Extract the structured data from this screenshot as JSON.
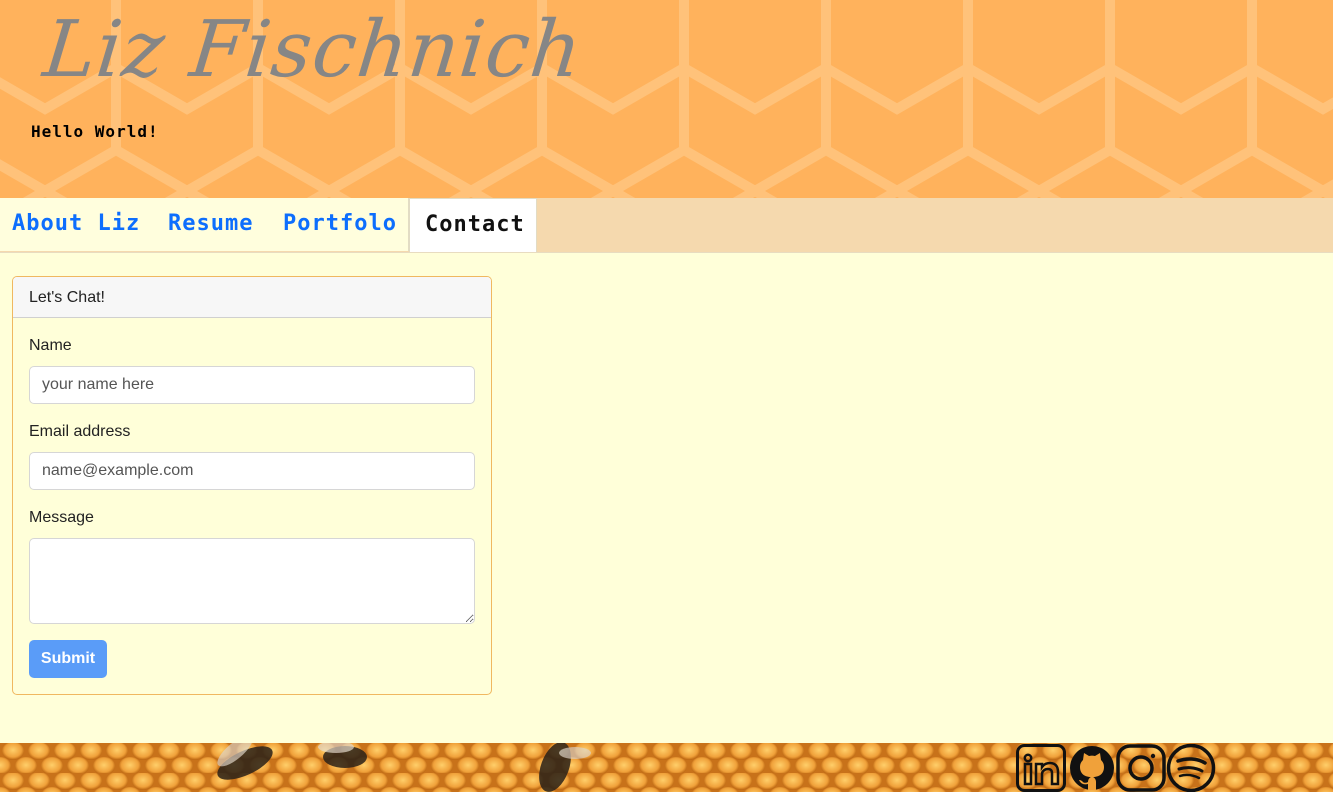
{
  "header": {
    "title": "Liz Fischnich",
    "tagline": "Hello World!"
  },
  "nav": {
    "tabs": [
      {
        "label": "About Liz",
        "active": false
      },
      {
        "label": "Resume",
        "active": false
      },
      {
        "label": "Portfolo",
        "active": false
      },
      {
        "label": "Contact",
        "active": true
      }
    ]
  },
  "contact_form": {
    "heading": "Let's Chat!",
    "name_label": "Name",
    "name_placeholder": "your name here",
    "name_value": "",
    "email_label": "Email address",
    "email_placeholder": "name@example.com",
    "email_value": "",
    "message_label": "Message",
    "message_value": "",
    "submit_label": "Submit"
  },
  "footer": {
    "social_icons": [
      "linkedin-icon",
      "github-icon",
      "instagram-icon",
      "spotify-icon"
    ]
  },
  "colors": {
    "header_bg": "#ffb25c",
    "title": "#868686",
    "nav_bg": "#f5d9ae",
    "nav_link": "#0d6efd",
    "page_bg": "#ffffd9",
    "card_border": "#f0b860",
    "button_bg": "#5a9cf8"
  }
}
